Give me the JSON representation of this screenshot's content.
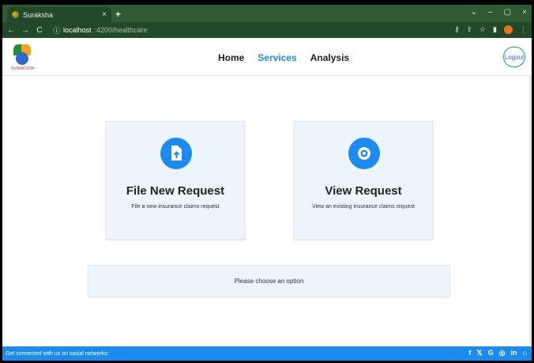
{
  "browser": {
    "tab_title": "Suraksha",
    "tab_close": "×",
    "new_tab": "+",
    "url_host": "localhost",
    "url_path": ":4200/healthcare",
    "window_controls": [
      "⌄",
      "–",
      "▢",
      "×"
    ]
  },
  "app": {
    "logo_text": "SURAKSHA",
    "nav": [
      {
        "label": "Home"
      },
      {
        "label": "Services"
      },
      {
        "label": "Analysis"
      }
    ],
    "logout_label": "Logout"
  },
  "cards": [
    {
      "title": "File New Request",
      "description": "File a new insurance claims request",
      "icon": "file-upload-icon"
    },
    {
      "title": "View Request",
      "description": "View an existing insurance claims request",
      "icon": "eye-icon"
    }
  ],
  "prompt": "Please choose an option",
  "footer": {
    "text": "Get connected with us on social networks:",
    "social": [
      "f",
      "𝕏",
      "G",
      "◎",
      "in",
      "⌂"
    ]
  },
  "colors": {
    "accent": "#1c8bf0",
    "card_bg": "#eef4fb",
    "browser_chrome": "#2f5a34"
  }
}
